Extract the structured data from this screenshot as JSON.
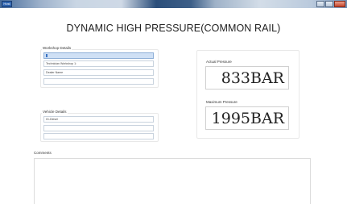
{
  "window": {
    "icon_label": "Host"
  },
  "page": {
    "title": "DYNAMIC HIGH PRESSURE(COMMON RAIL)"
  },
  "workshop": {
    "label": "Workshop Details",
    "fields": [
      "",
      "Technician  Workshop 1:",
      "Dealer Name",
      ""
    ]
  },
  "vehicle": {
    "label": "Vehicle Details",
    "fields": [
      "IG-Diesel",
      "",
      ""
    ]
  },
  "actual": {
    "label": "Actual Pressure",
    "value": "833BAR"
  },
  "maximum": {
    "label": "Maximum Pressure",
    "value": "1995BAR"
  },
  "comments": {
    "label": "Comments",
    "value": ""
  }
}
